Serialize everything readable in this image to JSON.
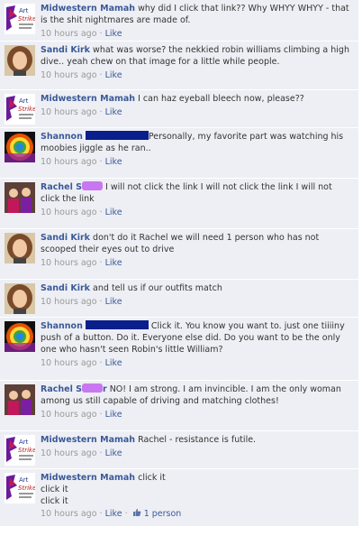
{
  "comments": [
    {
      "author": "Midwestern Mamah",
      "text": "why did I click that link?? Why WHYY WHYY - that is the shit nightmares are made of.",
      "time": "10 hours ago",
      "like": "Like"
    },
    {
      "author": "Sandi Kirk",
      "text": "what was worse? the nekkied robin williams climbing a high dive.. yeah chew on that image for a little while people.",
      "time": "10 hours ago",
      "like": "Like"
    },
    {
      "author": "Midwestern Mamah",
      "text": "I can haz eyeball bleech now, please??",
      "time": "10 hours ago",
      "like": "Like"
    },
    {
      "author": "Shannon",
      "text": "Personally, my favorite part was watching his moobies jiggle as he ran..",
      "time": "10 hours ago",
      "like": "Like"
    },
    {
      "author": "Rachel S",
      "text": "I will not click the link I will not click the link I will not click the link",
      "time": "10 hours ago",
      "like": "Like"
    },
    {
      "author": "Sandi Kirk",
      "text": "don't do it Rachel we will need 1 person who has not scooped their eyes out to drive",
      "time": "10 hours ago",
      "like": "Like"
    },
    {
      "author": "Sandi Kirk",
      "text": "and tell us if our outfits match",
      "time": "10 hours ago",
      "like": "Like"
    },
    {
      "author": "Shannon",
      "text": "Click it. You know you want to. just one tiiiiny push of a button. Do it. Everyone else did. Do you want to be the only one who hasn't seen Robin's little William?",
      "time": "10 hours ago",
      "like": "Like"
    },
    {
      "author": "Rachel S",
      "author_tail": "r",
      "text": "NO! I am strong. I am invincible. I am the only woman among us still capable of driving and matching clothes!",
      "time": "10 hours ago",
      "like": "Like"
    },
    {
      "author": "Midwestern Mamah",
      "text": "Rachel - resistance is futile.",
      "time": "10 hours ago",
      "like": "Like"
    },
    {
      "author": "Midwestern Mamah",
      "text": "click it",
      "text2": "click it",
      "text3": "click it",
      "time": "10 hours ago",
      "like": "Like",
      "like_count": "1 person"
    }
  ],
  "separator": "·",
  "avatar_text": {
    "line1": "Art",
    "line2": "Strike"
  },
  "colors": {
    "background": "#edeff4",
    "author_link": "#3b5998",
    "meta": "#999999",
    "redact_blue": "#0a1f8c",
    "redact_purple": "#c977f0"
  }
}
